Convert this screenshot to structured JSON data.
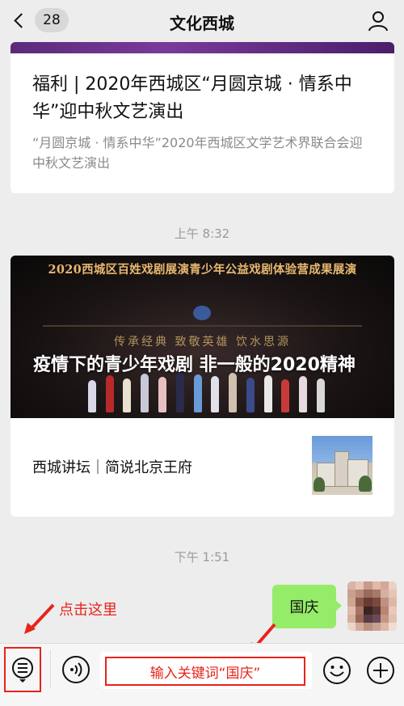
{
  "nav": {
    "badge_count": "28",
    "title": "文化西城"
  },
  "card1": {
    "title": "福利 | 2020年西城区“月圆京城 · 情系中华”迎中秋文艺演出",
    "description": "“月圆京城 · 情系中华”2020年西城区文学艺术界联合会迎中秋文艺演出"
  },
  "timestamp1": "上午 8:32",
  "card2": {
    "banner_text": "2020西城区百姓戏剧展演青少年公益戏剧体验营成果展演",
    "tagline": "传承经典 致敬英雄 饮水思源",
    "hero_title": "疫情下的青少年戏剧 非一般的2020精神",
    "sub_title": "西城讲坛｜简说北京王府"
  },
  "timestamp2": "下午 1:51",
  "message": {
    "text": "国庆"
  },
  "annotation": {
    "click_here": "点击这里"
  },
  "input": {
    "hint": "输入关键词“国庆”"
  },
  "colors": {
    "accent_red": "#e8231a",
    "bubble_green": "#95ec69",
    "background": "#ededed"
  }
}
